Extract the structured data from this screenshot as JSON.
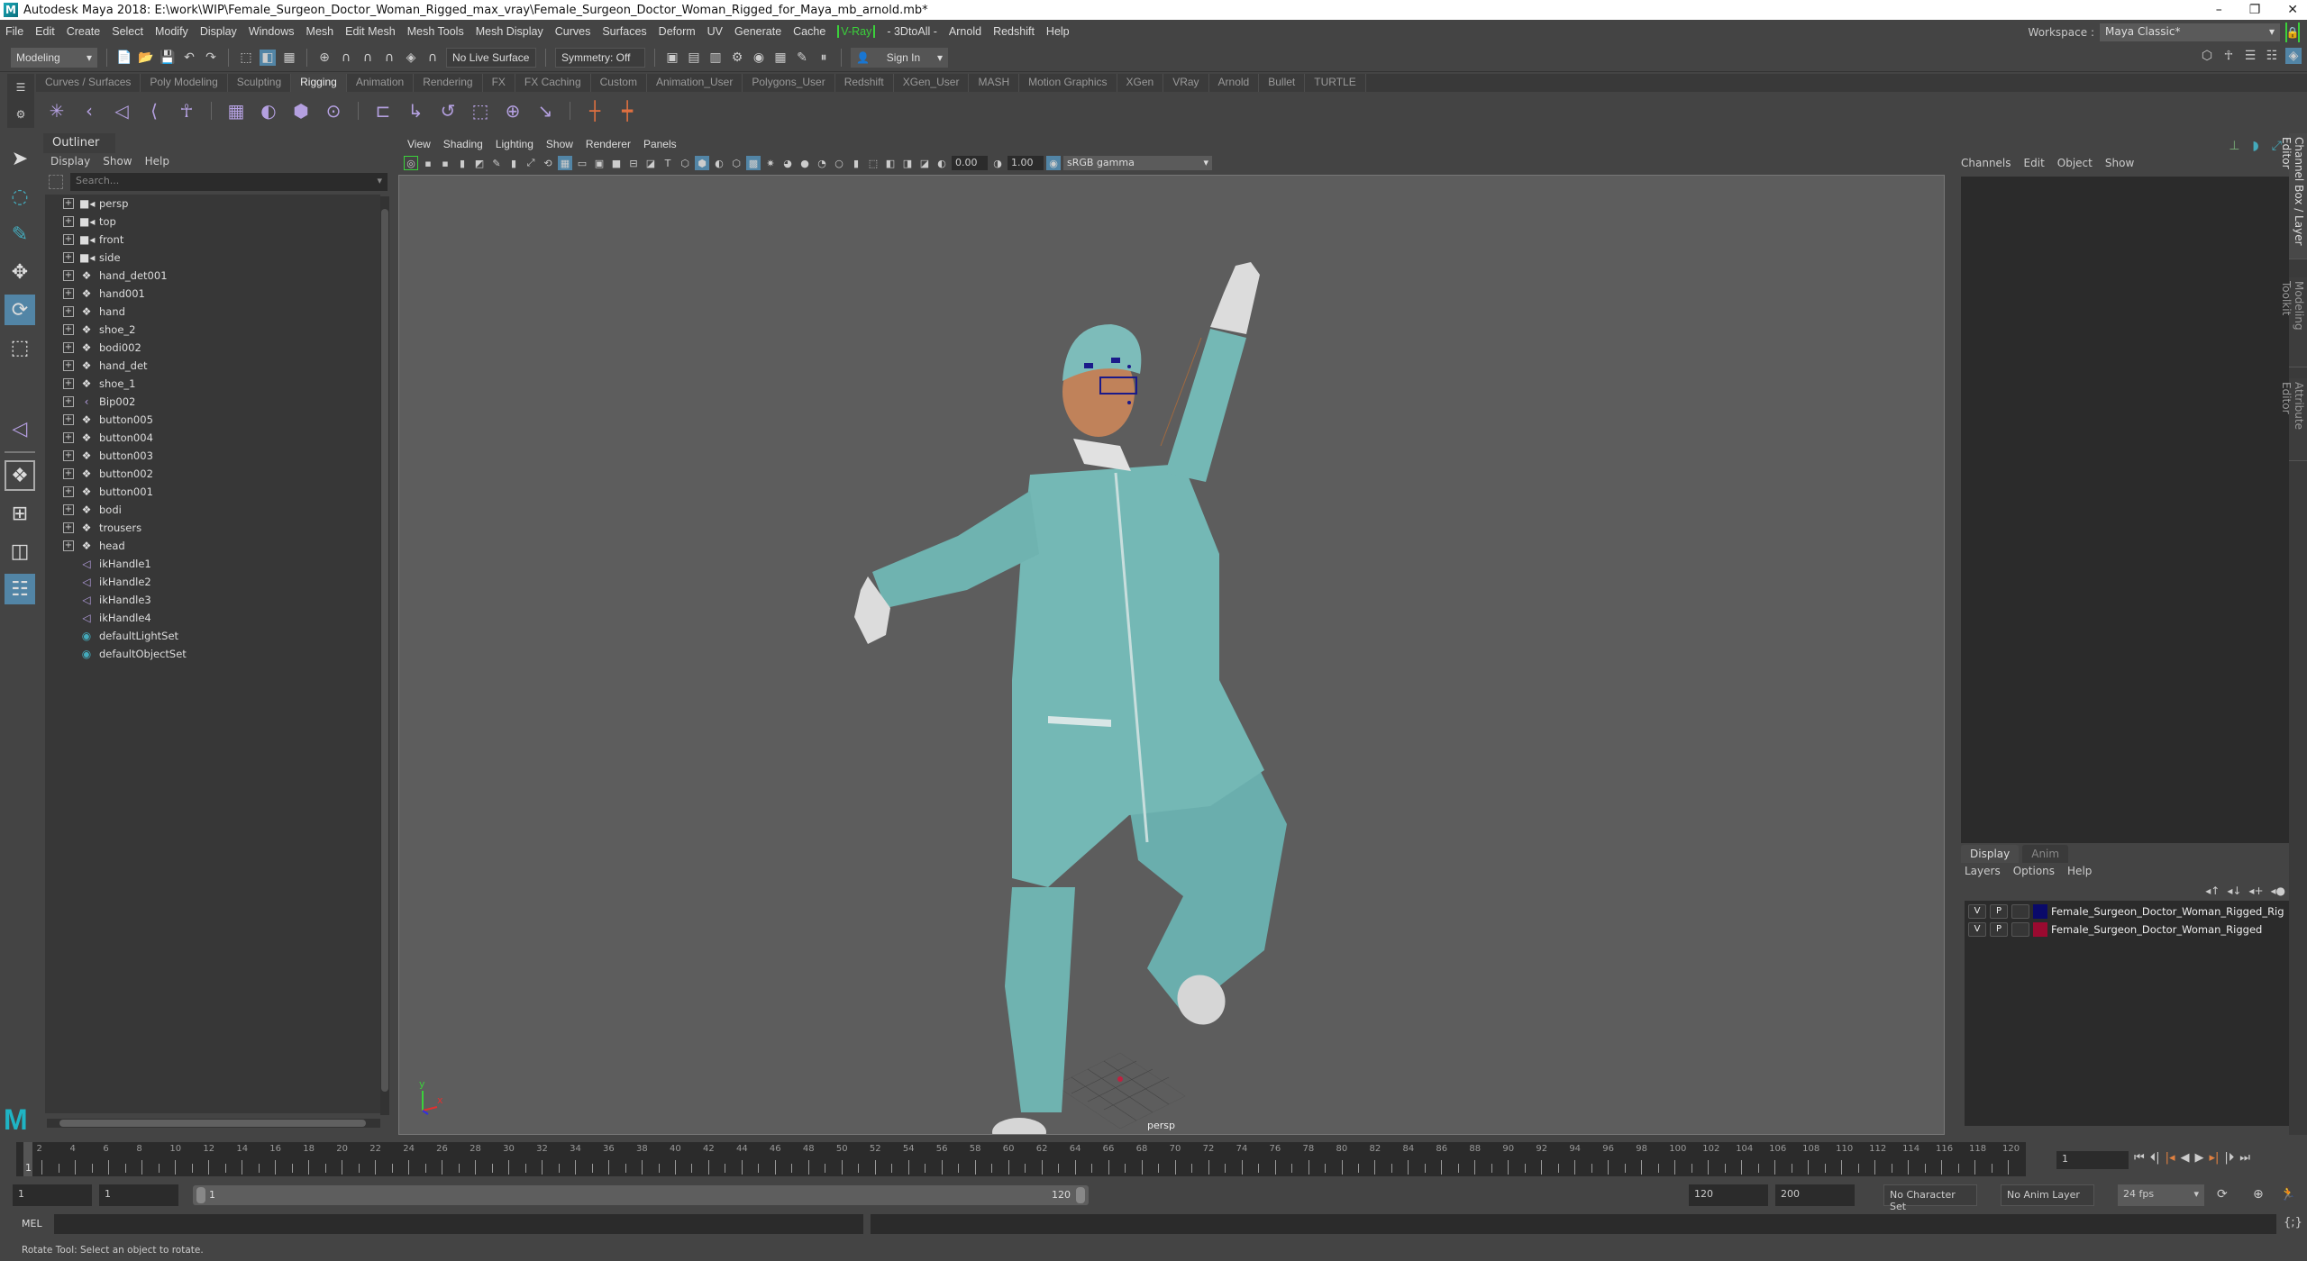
{
  "title": "Autodesk Maya 2018: E:\\work\\WIP\\Female_Surgeon_Doctor_Woman_Rigged_max_vray\\Female_Surgeon_Doctor_Woman_Rigged_for_Maya_mb_arnold.mb*",
  "window_controls": {
    "minimize": "–",
    "restore": "❐",
    "close": "✕"
  },
  "menubar": [
    "File",
    "Edit",
    "Create",
    "Select",
    "Modify",
    "Display",
    "Windows",
    "Mesh",
    "Edit Mesh",
    "Mesh Tools",
    "Mesh Display",
    "Curves",
    "Surfaces",
    "Deform",
    "UV",
    "Generate",
    "Cache",
    "V-Ray",
    "- 3DtoAll -",
    "Arnold",
    "Redshift",
    "Help"
  ],
  "workspace": {
    "label": "Workspace :",
    "value": "Maya Classic*"
  },
  "statusline": {
    "menuset": "Modeling",
    "live_surface": "No Live Surface",
    "symmetry": "Symmetry: Off",
    "sign_in": "Sign In"
  },
  "shelf": {
    "tabs": [
      "Curves / Surfaces",
      "Poly Modeling",
      "Sculpting",
      "Rigging",
      "Animation",
      "Rendering",
      "FX",
      "FX Caching",
      "Custom",
      "Animation_User",
      "Polygons_User",
      "Redshift",
      "XGen_User",
      "MASH",
      "Motion Graphics",
      "XGen",
      "VRay",
      "Arnold",
      "Bullet",
      "TURTLE"
    ],
    "active_tab": "Rigging",
    "icons": [
      "create-joints",
      "insert-joint",
      "ik-handle",
      "ik-spline",
      "quick-rig",
      "paint-weights",
      "bind-skin",
      "lattice",
      "cluster",
      "parent-constraint",
      "point-constraint",
      "orient-constraint",
      "scale-constraint",
      "aim-constraint",
      "pole-vector-constraint",
      "locator-orange",
      "locator-constraint-orange"
    ]
  },
  "outliner": {
    "title": "Outliner",
    "menu": [
      "Display",
      "Show",
      "Help"
    ],
    "search_placeholder": "Search...",
    "items": [
      {
        "name": "persp",
        "type": "camera",
        "expandable": true
      },
      {
        "name": "top",
        "type": "camera",
        "expandable": true
      },
      {
        "name": "front",
        "type": "camera",
        "expandable": true
      },
      {
        "name": "side",
        "type": "camera",
        "expandable": true
      },
      {
        "name": "hand_det001",
        "type": "mesh",
        "expandable": true
      },
      {
        "name": "hand001",
        "type": "mesh",
        "expandable": true
      },
      {
        "name": "hand",
        "type": "mesh",
        "expandable": true
      },
      {
        "name": "shoe_2",
        "type": "mesh",
        "expandable": true
      },
      {
        "name": "bodi002",
        "type": "mesh",
        "expandable": true
      },
      {
        "name": "hand_det",
        "type": "mesh",
        "expandable": true
      },
      {
        "name": "shoe_1",
        "type": "mesh",
        "expandable": true
      },
      {
        "name": "Bip002",
        "type": "joint",
        "expandable": true
      },
      {
        "name": "button005",
        "type": "mesh",
        "expandable": true
      },
      {
        "name": "button004",
        "type": "mesh",
        "expandable": true
      },
      {
        "name": "button003",
        "type": "mesh",
        "expandable": true
      },
      {
        "name": "button002",
        "type": "mesh",
        "expandable": true
      },
      {
        "name": "button001",
        "type": "mesh",
        "expandable": true
      },
      {
        "name": "bodi",
        "type": "mesh",
        "expandable": true
      },
      {
        "name": "trousers",
        "type": "mesh",
        "expandable": true
      },
      {
        "name": "head",
        "type": "mesh",
        "expandable": true
      },
      {
        "name": "ikHandle1",
        "type": "ik",
        "expandable": false
      },
      {
        "name": "ikHandle2",
        "type": "ik",
        "expandable": false
      },
      {
        "name": "ikHandle3",
        "type": "ik",
        "expandable": false
      },
      {
        "name": "ikHandle4",
        "type": "ik",
        "expandable": false
      },
      {
        "name": "defaultLightSet",
        "type": "set",
        "expandable": false
      },
      {
        "name": "defaultObjectSet",
        "type": "set",
        "expandable": false
      }
    ]
  },
  "viewport": {
    "menu": [
      "View",
      "Shading",
      "Lighting",
      "Show",
      "Renderer",
      "Panels"
    ],
    "exposure": "0.00",
    "gamma": "1.00",
    "color_space": "sRGB gamma",
    "camera_label": "persp",
    "axis_labels": {
      "y": "y",
      "x": "x"
    },
    "colors": {
      "scrubs": "#6fb3b0",
      "skin": "#c0825a",
      "white": "#d8d8d8",
      "rig": "#1a1a8a"
    }
  },
  "channelbox": {
    "menu": [
      "Channels",
      "Edit",
      "Object",
      "Show"
    ]
  },
  "layer_editor": {
    "tabs": [
      "Display",
      "Anim"
    ],
    "active_tab": "Display",
    "menu": [
      "Layers",
      "Options",
      "Help"
    ],
    "layers": [
      {
        "v": "V",
        "p": "P",
        "color": "#0a0a6a",
        "name": "Female_Surgeon_Doctor_Woman_Rigged_Rig"
      },
      {
        "v": "V",
        "p": "P",
        "color": "#9a0a30",
        "name": "Female_Surgeon_Doctor_Woman_Rigged"
      }
    ]
  },
  "side_tabs": [
    "Channel Box / Layer Editor",
    "Modeling Toolkit",
    "Attribute Editor"
  ],
  "timeline": {
    "start": 1,
    "end": 120,
    "current_frame": "1",
    "tick_labels": [
      "2",
      "4",
      "6",
      "8",
      "10",
      "12",
      "14",
      "16",
      "18",
      "20",
      "22",
      "24",
      "26",
      "28",
      "30",
      "32",
      "34",
      "36",
      "38",
      "40",
      "42",
      "44",
      "46",
      "48",
      "50",
      "52",
      "54",
      "56",
      "58",
      "60",
      "62",
      "64",
      "66",
      "68",
      "70",
      "72",
      "74",
      "76",
      "78",
      "80",
      "82",
      "84",
      "86",
      "88",
      "90",
      "92",
      "94",
      "96",
      "98",
      "100",
      "102",
      "104",
      "106",
      "108",
      "110",
      "112",
      "114",
      "116",
      "118",
      "120"
    ],
    "current_label": "1"
  },
  "range": {
    "start_field": "1",
    "playback_start": "1",
    "slider_start": "1",
    "slider_end": "120",
    "playback_end": "120",
    "end_field": "200",
    "character_set": "No Character Set",
    "anim_layer": "No Anim Layer",
    "fps": "24 fps"
  },
  "mel": {
    "label": "MEL"
  },
  "helpline": "Rotate Tool: Select an object to rotate."
}
